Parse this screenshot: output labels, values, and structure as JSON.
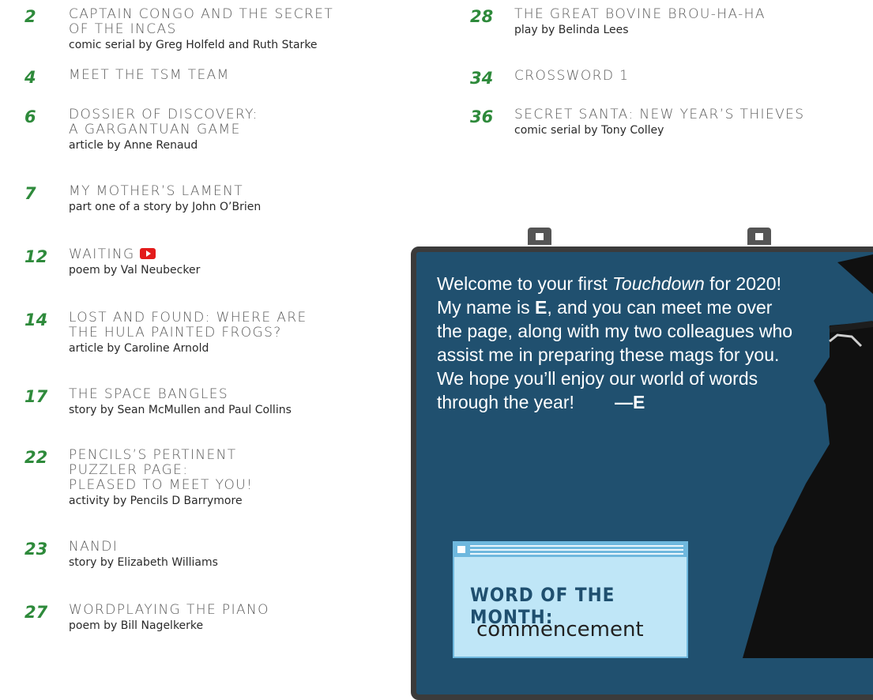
{
  "contents_left": [
    {
      "num": "2",
      "title": "CAPTAIN CONGO AND THE SECRET\nOF THE INCAS",
      "byline": "comic serial by Greg Holfeld and Ruth Starke"
    },
    {
      "num": "4",
      "title": "MEET THE TSM TEAM",
      "byline": ""
    },
    {
      "num": "6",
      "title": "DOSSIER OF DISCOVERY:\nA GARGANTUAN GAME",
      "byline": "article by Anne Renaud"
    },
    {
      "num": "7",
      "title": "MY MOTHER’S LAMENT",
      "byline": "part one of a story by John O’Brien"
    },
    {
      "num": "12",
      "title": "WAITING",
      "byline": "poem by Val Neubecker",
      "video_icon": "youtube-icon"
    },
    {
      "num": "14",
      "title": "LOST AND FOUND: WHERE ARE\nTHE HULA PAINTED FROGS?",
      "byline": "article by Caroline Arnold"
    },
    {
      "num": "17",
      "title": "THE SPACE BANGLES",
      "byline": "story by Sean McMullen and Paul Collins"
    },
    {
      "num": "22",
      "title": "PENCILS’S PERTINENT\nPUZZLER PAGE:\nPLEASED TO MEET YOU!",
      "byline": "activity by Pencils D Barrymore"
    },
    {
      "num": "23",
      "title": "NANDI",
      "byline": "story by Elizabeth Williams"
    },
    {
      "num": "27",
      "title": "WORDPLAYING THE PIANO",
      "byline": "poem by Bill Nagelkerke"
    }
  ],
  "contents_right": [
    {
      "num": "28",
      "title": "THE GREAT BOVINE BROU-HA-HA",
      "byline": "play by Belinda Lees"
    },
    {
      "num": "34",
      "title": "CROSSWORD 1",
      "byline": ""
    },
    {
      "num": "36",
      "title": "SECRET SANTA: NEW YEAR’S THIEVES",
      "byline": "comic serial by Tony Colley"
    }
  ],
  "welcome": {
    "p1": "Welcome to your first ",
    "italic": "Touchdown",
    "p2": " for 2020! My name is ",
    "bold_name": "E",
    "p3": ", and you can meet me over the page, along with my two colleagues who assist me in preparing these mags for you. We hope you’ll enjoy our world of words through the year!",
    "signature": "—E"
  },
  "word_of_month": {
    "label": "WORD OF THE MONTH:",
    "word": "commencement"
  },
  "colors": {
    "page_number": "#2e8a3b",
    "board": "#20506f",
    "board_frame": "#3b3b3b",
    "wotm_bg": "#bfe6f7",
    "wotm_border": "#6fb8de",
    "video_icon": "#e31b1b"
  }
}
